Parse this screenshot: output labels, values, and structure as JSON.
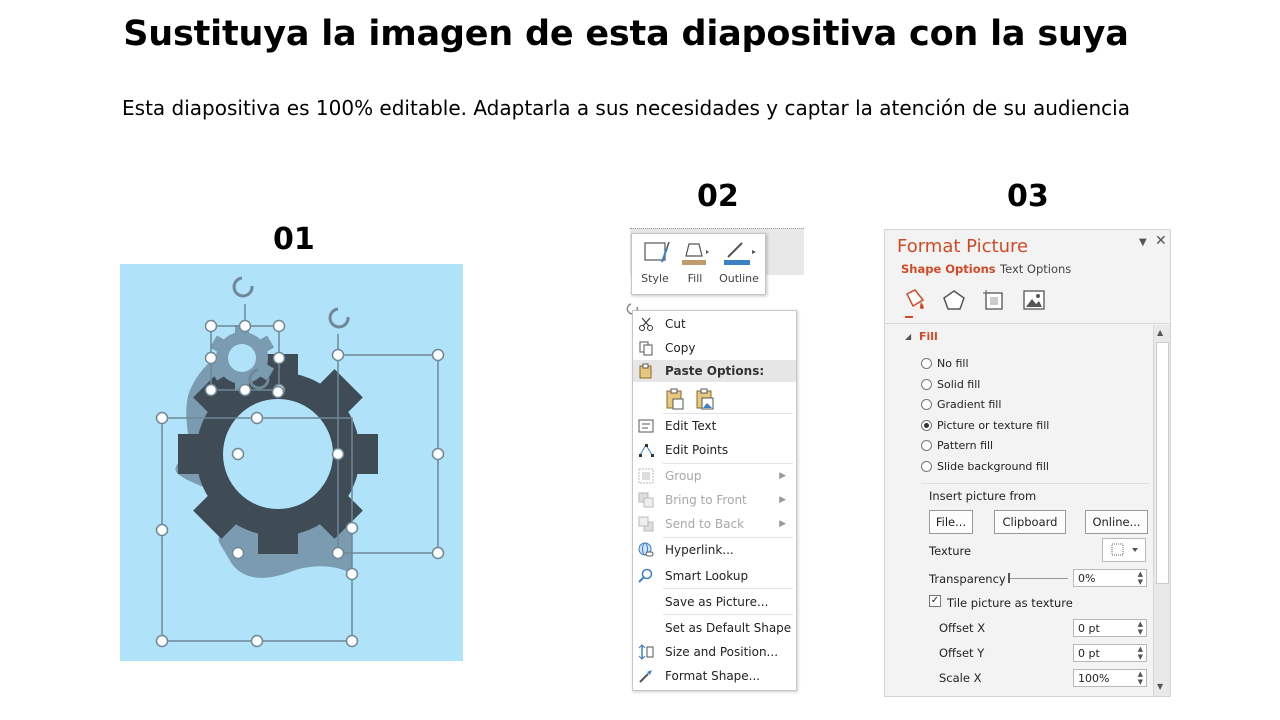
{
  "slide": {
    "title": "Sustituya la imagen de esta diapositiva con la suya",
    "subtitle": "Esta diapositiva es 100% editable. Adaptarla a sus necesidades y captar la atención de su audiencia",
    "numbers": [
      "01",
      "02",
      "03"
    ]
  },
  "colors": {
    "panel1_background": "#b0e2f9",
    "head": "#7a9bb0",
    "gear": "#3f4c56",
    "accent": "#d04a26"
  },
  "mini_toolbar": {
    "items": [
      {
        "label": "Style",
        "icon": "style-brush-icon"
      },
      {
        "label": "Fill",
        "icon": "paint-bucket-icon"
      },
      {
        "label": "Outline",
        "icon": "outline-pen-icon"
      }
    ]
  },
  "context_menu": {
    "cut": "Cut",
    "copy": "Copy",
    "paste_options": "Paste Options:",
    "edit_text": "Edit Text",
    "edit_points": "Edit Points",
    "group": "Group",
    "bring_to_front": "Bring to Front",
    "send_to_back": "Send to Back",
    "hyperlink": "Hyperlink...",
    "smart_lookup": "Smart Lookup",
    "save_as_picture": "Save as Picture...",
    "set_default_shape": "Set as Default Shape",
    "size_position": "Size and Position...",
    "format_shape": "Format Shape..."
  },
  "format_pane": {
    "title": "Format Picture",
    "tab_shape": "Shape Options",
    "tab_text": "Text Options",
    "section": "Fill",
    "fill_options": [
      {
        "label": "No fill",
        "checked": false
      },
      {
        "label": "Solid fill",
        "checked": false
      },
      {
        "label": "Gradient fill",
        "checked": false
      },
      {
        "label": "Picture or texture fill",
        "checked": true
      },
      {
        "label": "Pattern fill",
        "checked": false
      },
      {
        "label": "Slide background fill",
        "checked": false
      }
    ],
    "insert_from": "Insert picture from",
    "btn_file": "File...",
    "btn_clipboard": "Clipboard",
    "btn_online": "Online...",
    "texture": "Texture",
    "transparency": "Transparency",
    "transparency_value": "0%",
    "tile": "Tile picture as texture",
    "tile_checked": true,
    "offset_x": "Offset X",
    "offset_x_value": "0 pt",
    "offset_y": "Offset Y",
    "offset_y_value": "0 pt",
    "scale_x": "Scale X",
    "scale_x_value": "100%"
  }
}
